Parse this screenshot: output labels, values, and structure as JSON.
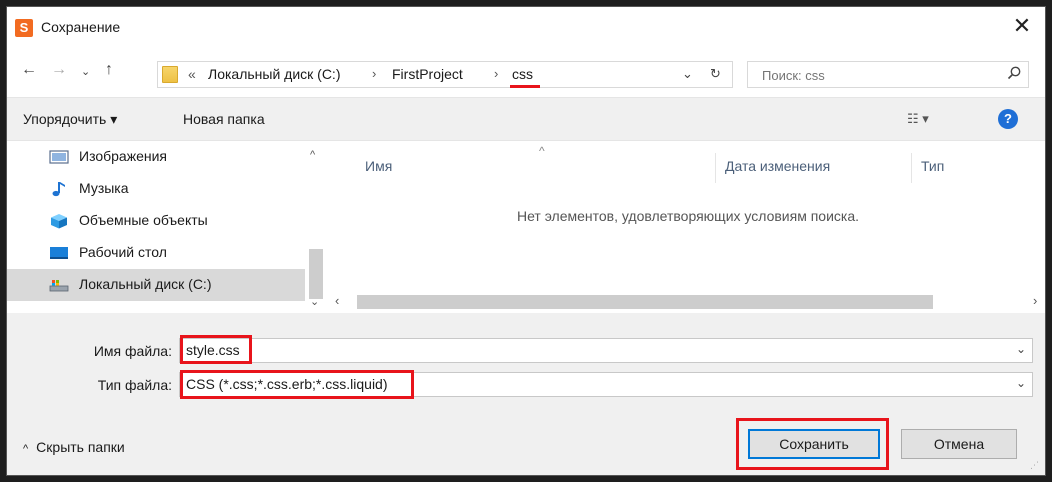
{
  "window": {
    "title": "Сохранение",
    "app_icon": "S"
  },
  "nav": {
    "breadcrumb": [
      "«",
      "Локальный диск (C:)",
      "FirstProject",
      "css"
    ],
    "search_placeholder": "Поиск: css"
  },
  "toolbar": {
    "organize": "Упорядочить ▾",
    "new_folder": "Новая папка"
  },
  "sidebar": {
    "items": [
      {
        "label": "Изображения",
        "icon": "pictures-icon"
      },
      {
        "label": "Музыка",
        "icon": "music-icon"
      },
      {
        "label": "Объемные объекты",
        "icon": "3d-objects-icon"
      },
      {
        "label": "Рабочий стол",
        "icon": "desktop-icon"
      },
      {
        "label": "Локальный диск (C:)",
        "icon": "drive-icon",
        "selected": true
      }
    ]
  },
  "content": {
    "columns": [
      "Имя",
      "Дата изменения",
      "Тип"
    ],
    "empty_message": "Нет элементов, удовлетворяющих условиям поиска."
  },
  "form": {
    "filename_label": "Имя файла:",
    "filename_value": "style.css",
    "filetype_label": "Тип файла:",
    "filetype_value": "CSS (*.css;*.css.erb;*.css.liquid)"
  },
  "footer": {
    "hide_folders": "Скрыть папки",
    "save": "Сохранить",
    "cancel": "Отмена"
  },
  "colors": {
    "highlight": "#e8141b",
    "accent": "#0078d7",
    "help": "#1f6fd6"
  }
}
